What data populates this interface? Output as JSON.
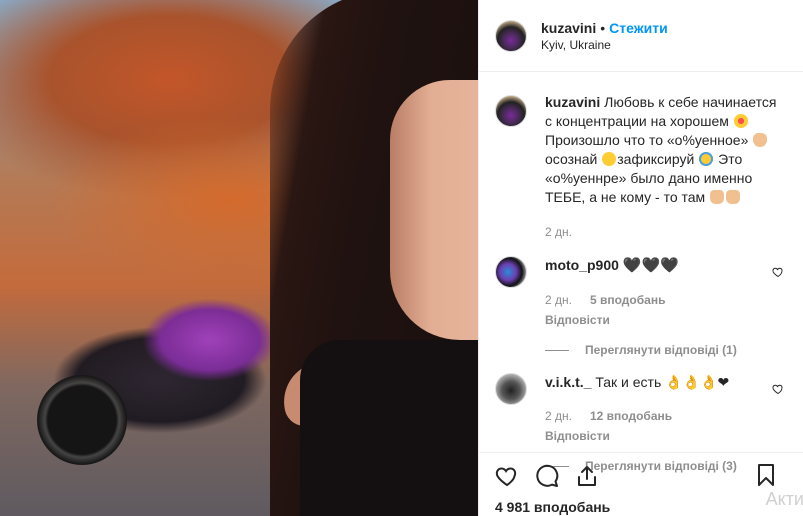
{
  "post": {
    "author": "kuzavini",
    "separator": "•",
    "follow_label": "Стежити",
    "location": "Kyiv, Ukraine"
  },
  "caption": {
    "username": "kuzavini",
    "text_1": "Любовь к себе начинается с концентрации на хорошем",
    "text_2": "Произошло что то «о%уенное»",
    "text_3": "осознай",
    "text_4": "зафиксируй",
    "text_5": "Это «о%уеннре» было дано именно ТЕБЕ, а не кому - то там",
    "time": "2 дн."
  },
  "comments": [
    {
      "username": "moto_p900",
      "text": "",
      "emojis": "🖤🖤🖤",
      "time": "2 дн.",
      "likes": "5 вподобань",
      "reply_label": "Відповісти",
      "view_replies": "Переглянути відповіді (1)"
    },
    {
      "username": "v.i.k.t._",
      "text": "Так и есть",
      "emojis": "👌👌👌❤",
      "time": "2 дн.",
      "likes": "12 вподобань",
      "reply_label": "Відповісти",
      "view_replies": "Переглянути відповіді (3)"
    }
  ],
  "actions": {
    "likes_count": "4 981 вподобань"
  },
  "watermark": "Акти",
  "colors": {
    "accent": "#0095f6",
    "muted": "#8e8e8e",
    "text": "#262626",
    "border": "#efefef"
  },
  "icons": [
    "heart-icon",
    "comment-icon",
    "share-icon",
    "bookmark-icon"
  ]
}
